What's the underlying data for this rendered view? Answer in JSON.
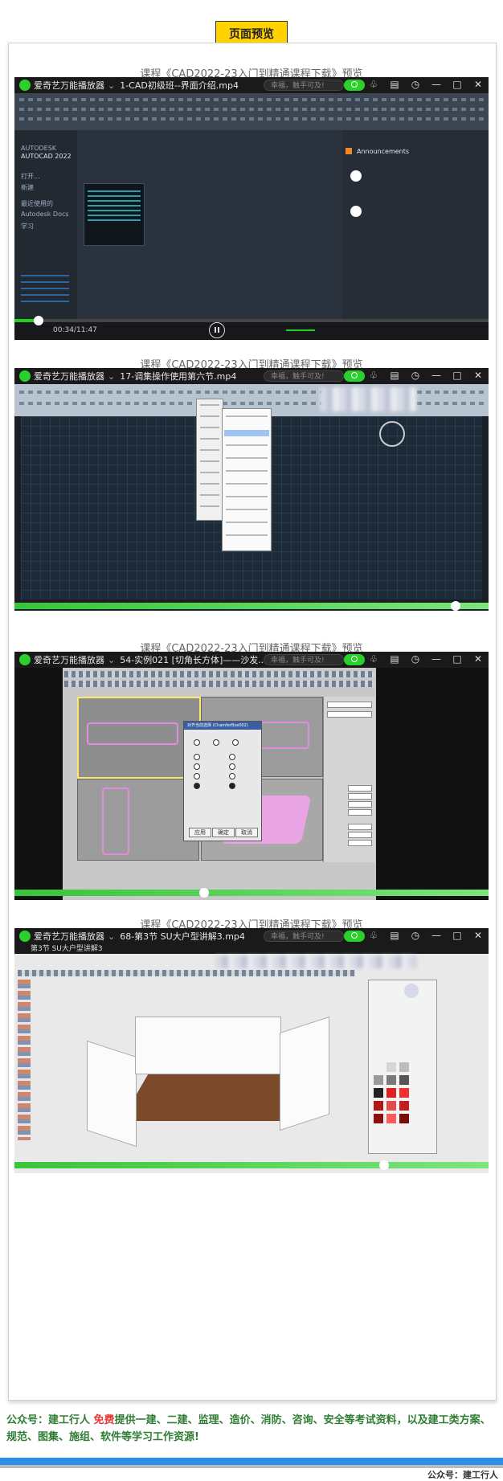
{
  "header": {
    "badge": "页面预览"
  },
  "previews": [
    {
      "caption": "课程《CAD2022-23入门到精通课程下载》预览",
      "player_name": "爱奇艺万能播放器",
      "file": "1-CAD初级班--界面介绍.mp4",
      "search_placeholder": "幸福，触手可及!",
      "elapsed": "00:34/11:47",
      "app": "AUTODESK",
      "app2": "AUTOCAD 2022",
      "announcements": "Announcements",
      "sidebar_items": [
        "打开...",
        "新建",
        "最近使用的",
        "Autodesk Docs",
        "学习"
      ],
      "progress": 0.05
    },
    {
      "caption": "课程《CAD2022-23入门到精通课程下载》预览",
      "player_name": "爱奇艺万能播放器",
      "file": "17-调集操作使用第六节.mp4",
      "search_placeholder": "幸福，触手可及!",
      "progress": 0.93
    },
    {
      "caption": "课程《CAD2022-23入门到精通课程下载》预览",
      "player_name": "爱奇艺万能播放器",
      "file": "54-实例021 [切角长方体]——沙发...",
      "search_placeholder": "幸福，触手可及!",
      "progress": 0.4,
      "dialog_title": "对齐当前选择 (ChamferBox002)",
      "dialog_buttons": [
        "应用",
        "确定",
        "取消"
      ]
    },
    {
      "caption": "课程《CAD2022-23入门到精通课程下载》预览",
      "player_name": "爱奇艺万能播放器",
      "file": "68-第3节 SU大户型讲解3.mp4",
      "search_placeholder": "幸福，触手可及!",
      "subtitle": "第3节 SU大户型讲解3",
      "progress": 0.78
    }
  ],
  "footer": {
    "lead": "公众号：建工行人",
    "free": "免费",
    "rest": "提供一建、二建、监理、造价、消防、咨询、安全等考试资料，以及建工类方案、规范、图集、施组、软件等学习工作资源!",
    "signature": "公众号：建工行人"
  },
  "colors": {
    "badge": "#ffd200",
    "player_green": "#2bd12b",
    "footer_green": "#2e7d32",
    "footer_red": "#e53935",
    "bar_blue": "#2d8ee8"
  }
}
